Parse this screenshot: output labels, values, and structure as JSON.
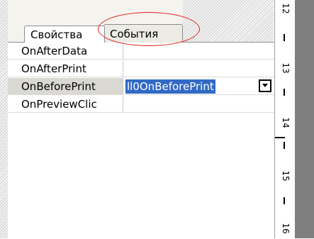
{
  "tabs": [
    {
      "label": "Свойства",
      "active": true
    },
    {
      "label": "События",
      "active": false
    }
  ],
  "properties": [
    {
      "name": "OnAfterData",
      "value": ""
    },
    {
      "name": "OnAfterPrint",
      "value": ""
    },
    {
      "name": "OnBeforePrint",
      "value": "ll0OnBeforePrint",
      "selected": true
    },
    {
      "name": "OnPreviewClic",
      "value": ""
    }
  ],
  "ruler": {
    "labels": [
      "12",
      "13",
      "14",
      "15",
      "16"
    ]
  },
  "colors": {
    "selection": "#316ac5",
    "highlight_ellipse": "#e02020",
    "ruler_border": "#a0a0a0",
    "right_panel": "#7f7f7f"
  },
  "icons": [
    "dropdown-arrow-icon"
  ]
}
